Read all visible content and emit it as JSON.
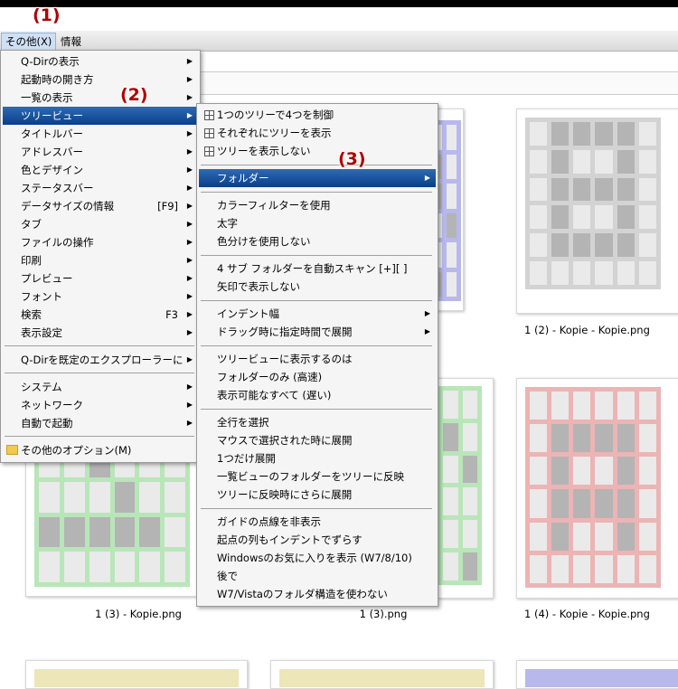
{
  "callouts": [
    "(1)",
    "(2)",
    "(3)"
  ],
  "menubar": {
    "items": [
      "その他(X)",
      "情報"
    ]
  },
  "menu1": {
    "items": [
      {
        "label": "Q-Dirの表示",
        "arrow": "▶"
      },
      {
        "label": "起動時の開き方",
        "arrow": "▶"
      },
      {
        "label": "一覧の表示",
        "arrow": "▶"
      },
      {
        "label": "ツリービュー",
        "arrow": "▶"
      },
      {
        "label": "タイトルバー",
        "arrow": "▶"
      },
      {
        "label": "アドレスバー",
        "arrow": "▶"
      },
      {
        "label": "色とデザイン",
        "arrow": "▶"
      },
      {
        "label": "ステータスバー",
        "arrow": "▶"
      },
      {
        "label": "データサイズの情報",
        "shortcut": "[F9]",
        "arrow": "▶"
      },
      {
        "label": "タブ",
        "arrow": "▶"
      },
      {
        "label": "ファイルの操作",
        "arrow": "▶"
      },
      {
        "label": "印刷",
        "arrow": "▶"
      },
      {
        "label": "プレビュー",
        "arrow": "▶"
      },
      {
        "label": "フォント",
        "arrow": "▶"
      },
      {
        "label": "検索",
        "shortcut": "F3",
        "arrow": "▶"
      },
      {
        "label": "表示設定",
        "arrow": "▶"
      },
      {
        "label": "Q-Dirを既定のエクスプローラーに",
        "arrow": "▶"
      },
      {
        "label": "システム",
        "arrow": "▶"
      },
      {
        "label": "ネットワーク",
        "arrow": "▶"
      },
      {
        "label": "自動で起動",
        "arrow": "▶"
      },
      {
        "label": "その他のオプション(M)",
        "arrow": ""
      }
    ]
  },
  "menu2": {
    "items": [
      {
        "label": "1つのツリーで4つを制御"
      },
      {
        "label": "それぞれにツリーを表示"
      },
      {
        "label": "ツリーを表示しない"
      },
      {
        "label": "フォルダー",
        "arrow": "▶"
      },
      {
        "label": "カラーフィルターを使用"
      },
      {
        "label": "太字"
      },
      {
        "label": "色分けを使用しない"
      },
      {
        "label": "4 サブ フォルダーを自動スキャン [+][ ]"
      },
      {
        "label": "矢印で表示しない"
      },
      {
        "label": "インデント幅",
        "arrow": "▶"
      },
      {
        "label": "ドラッグ時に指定時間で展開",
        "arrow": "▶"
      },
      {
        "label": "ツリービューに表示するのは"
      },
      {
        "label": "フォルダーのみ (高速)"
      },
      {
        "label": "表示可能なすべて (遅い)"
      },
      {
        "label": "全行を選択"
      },
      {
        "label": "マウスで選択された時に展開"
      },
      {
        "label": "1つだけ展開"
      },
      {
        "label": "一覧ビューのフォルダーをツリーに反映"
      },
      {
        "label": "ツリーに反映時にさらに展開"
      },
      {
        "label": "ガイドの点線を非表示"
      },
      {
        "label": "起点の列もインデントでずらす"
      },
      {
        "label": "Windowsのお気に入りを表示 (W7/8/10)"
      },
      {
        "label": "後で"
      },
      {
        "label": "W7/Vistaのフォルダ構造を使わない"
      }
    ]
  },
  "captions": [
    "1 (2) - Kopie - Kopie.png",
    "1 (3) - Kopie.png",
    "1 (3).png",
    "1 (4) - Kopie - Kopie.png"
  ],
  "colors": {
    "blue": "#b8b8ec",
    "gray": "#d3d3d3",
    "green": "#b8e6b8",
    "red": "#ecb4b4",
    "yellow": "#ece6b8",
    "highlight": "#0a3f8a",
    "callout": "#b00000"
  }
}
